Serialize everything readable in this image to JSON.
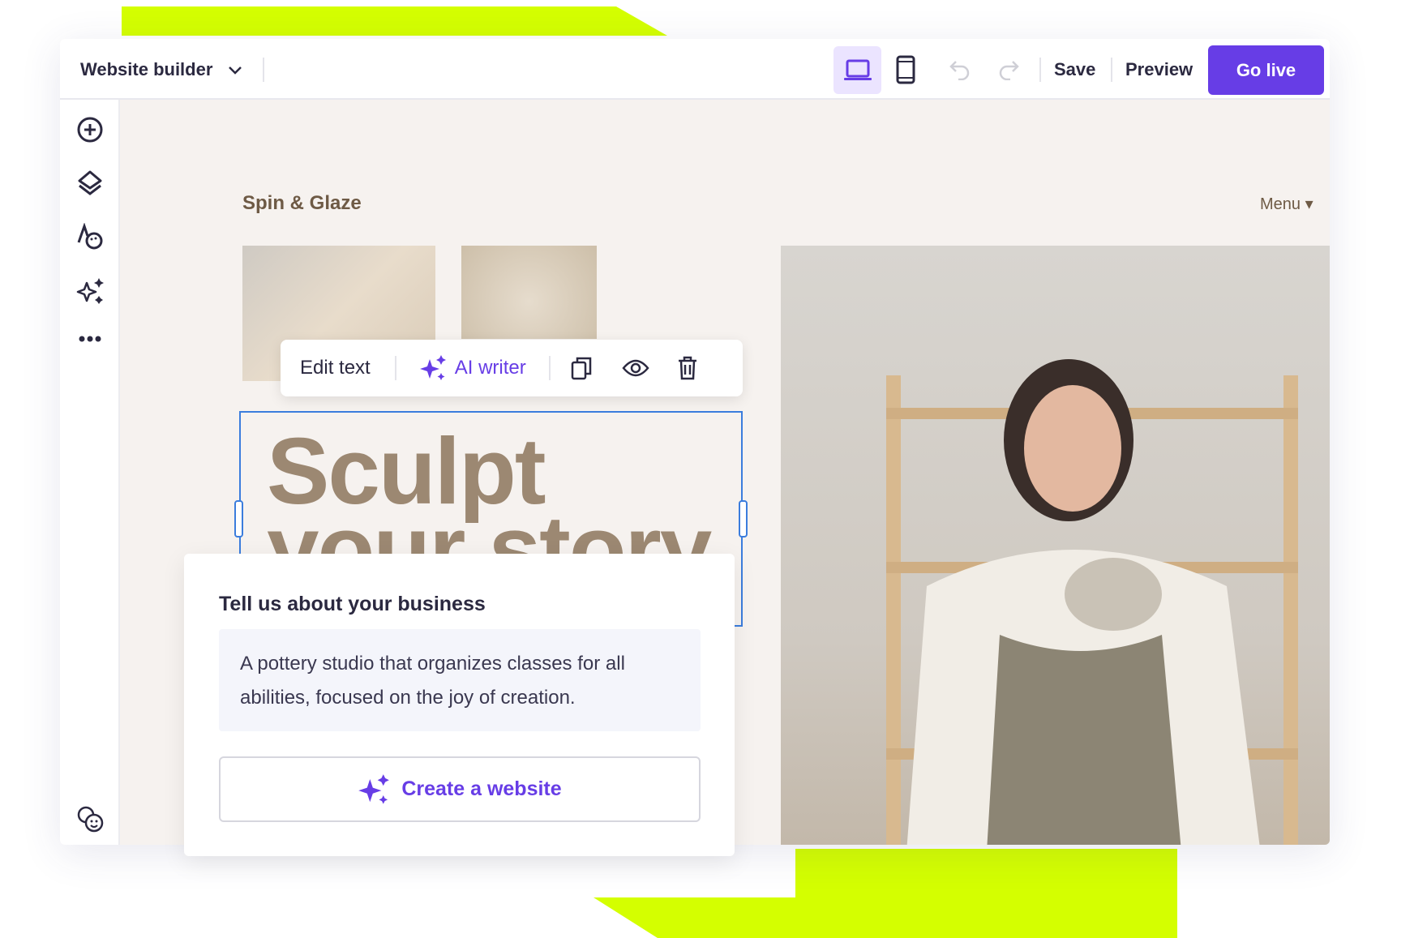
{
  "topbar": {
    "title": "Website builder",
    "save": "Save",
    "preview": "Preview",
    "go_live": "Go live"
  },
  "site": {
    "brand": "Spin & Glaze",
    "menu": "Menu ▾",
    "headline_line1": "Sculpt",
    "headline_line2": "your story"
  },
  "text_toolbar": {
    "edit_text": "Edit text",
    "ai_writer": "AI writer"
  },
  "form": {
    "title": "Tell us about your business",
    "description": "A pottery studio that organizes classes for all abilities, focused on the joy of creation.",
    "create_button": "Create a website"
  },
  "colors": {
    "accent": "#673de6",
    "lime": "#d4ff00",
    "selection": "#3b7ddd",
    "headline": "#9c8872"
  }
}
